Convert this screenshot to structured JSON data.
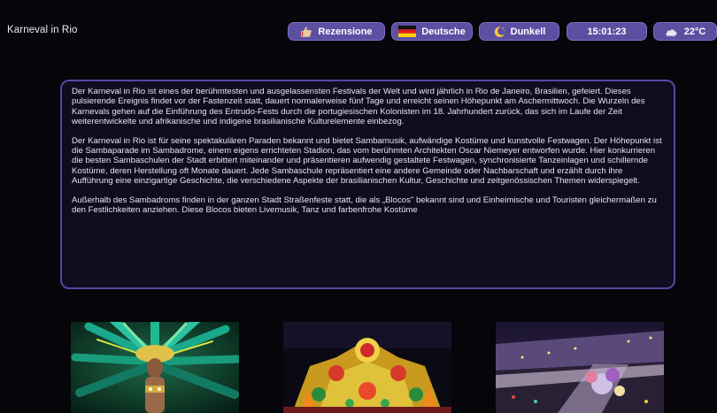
{
  "header": {
    "title": "Karneval in Rio",
    "buttons": {
      "review_label": "Rezensione",
      "language_label": "Deutsche",
      "theme_label": "Dunkell",
      "time_label": "15:01:23",
      "weather_label": "22°C"
    },
    "icons": {
      "review": "thumbs-up-icon",
      "language": "german-flag-icon",
      "theme": "moon-icon",
      "weather": "cloud-icon"
    }
  },
  "article": {
    "paragraphs": [
      "Der Karneval in Rio ist eines der berühmtesten und ausgelassensten Festivals der Welt und wird jährlich in Rio de Janeiro, Brasilien, gefeiert. Dieses pulsierende Ereignis findet vor der Fastenzeit statt, dauert normalerweise fünf Tage und erreicht seinen Höhepunkt am Aschermittwoch. Die Wurzeln des Karnevals gehen auf die Einführung des Entrudo-Fests durch die portugiesischen Kolonisten im 18. Jahrhundert zurück, das sich im Laufe der Zeit weiterentwickelte und afrikanische und indigene brasilianische Kulturelemente einbezog.",
      "Der Karneval in Rio ist für seine spektakulären Paraden bekannt und bietet Sambamusik, aufwändige Kostüme und kunstvolle Festwagen. Der Höhepunkt ist die Sambaparade im Sambadrome, einem eigens errichteten Stadion, das vom berühmten Architekten Oscar Niemeyer entworfen wurde. Hier konkurrieren die besten Sambaschulen der Stadt erbittert miteinander und präsentieren aufwendig gestaltete Festwagen, synchronisierte Tanzeinlagen und schillernde Kostüme, deren Herstellung oft Monate dauert. Jede Sambaschule repräsentiert eine andere Gemeinde oder Nachbarschaft und erzählt durch ihre Aufführung eine einzigartige Geschichte, die verschiedene Aspekte der brasilianischen Kultur, Geschichte und zeitgenössischen Themen widerspiegelt.",
      "Außerhalb des Sambadroms finden in der ganzen Stadt Straßenfeste statt, die als „Blocos\" bekannt sind und Einheimische und Touristen gleichermaßen zu den Festlichkeiten anziehen. Diese Blocos bieten Livemusik, Tanz und farbenfrohe Kostüme"
    ]
  },
  "gallery": {
    "images": [
      {
        "name": "feathered-dancer-photo"
      },
      {
        "name": "carnival-float-photo"
      },
      {
        "name": "sambadrome-parade-photo"
      }
    ]
  },
  "colors": {
    "pill_bg": "#5c4fa1",
    "panel_border": "#5548a0",
    "page_bg": "#05050a"
  }
}
